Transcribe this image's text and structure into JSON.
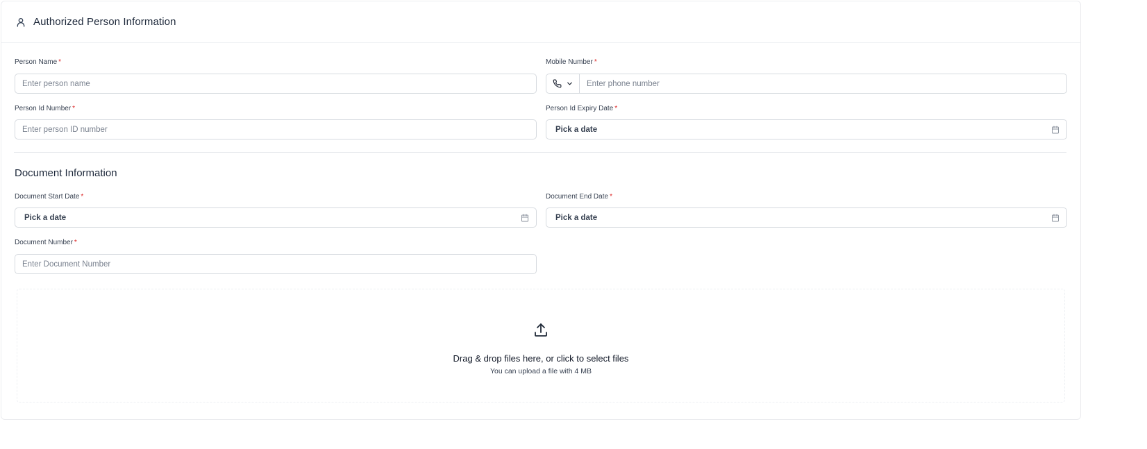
{
  "header": {
    "title": "Authorized Person Information",
    "icon": "user-icon"
  },
  "fields": {
    "person_name": {
      "label": "Person Name",
      "required": "*",
      "placeholder": "Enter person name"
    },
    "mobile_number": {
      "label": "Mobile Number",
      "required": "*",
      "placeholder": "Enter phone number"
    },
    "person_id_number": {
      "label": "Person Id Number",
      "required": "*",
      "placeholder": "Enter person ID number"
    },
    "person_id_expiry": {
      "label": "Person Id Expiry Date",
      "required": "*",
      "value": "Pick a date"
    }
  },
  "document": {
    "title": "Document Information",
    "start_date": {
      "label": "Document Start Date",
      "required": "*",
      "value": "Pick a date"
    },
    "end_date": {
      "label": "Document End Date",
      "required": "*",
      "value": "Pick a date"
    },
    "number": {
      "label": "Document Number",
      "required": "*",
      "placeholder": "Enter Document Number"
    }
  },
  "upload": {
    "title": "Drag & drop files here, or click to select files",
    "subtitle": "You can upload a file with 4 MB"
  },
  "colors": {
    "required": "#dc2626",
    "border": "#d6dadf",
    "placeholder": "#7a828f"
  }
}
